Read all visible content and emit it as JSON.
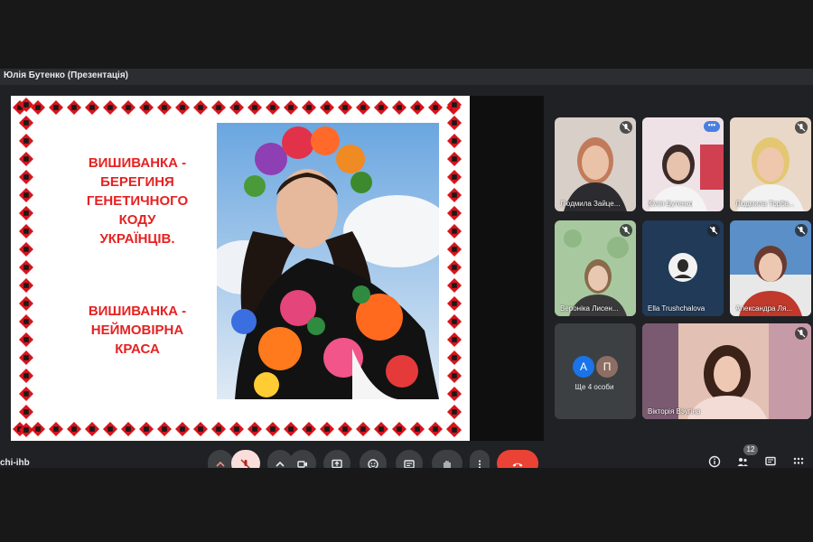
{
  "presenter": {
    "label": "Юлія Бутенко (Презентація)"
  },
  "slide": {
    "line1": [
      "ВИШИВАНКА  -",
      "БЕРЕГИНЯ",
      "ГЕНЕТИЧНОГО",
      "КОДУ",
      "УКРАЇНЦІВ."
    ],
    "line2": [
      "ВИШИВАНКА -",
      "НЕЙМОВІРНА",
      "КРАСА"
    ]
  },
  "participants": [
    {
      "name": "Людмила Зайце...",
      "muted": true
    },
    {
      "name": "Юлія Бутенко",
      "speaking": true,
      "menu": "•••"
    },
    {
      "name": "Людмила Торба...",
      "muted": true
    },
    {
      "name": "Вероніка Лисен...",
      "muted": true
    },
    {
      "name": "Ella Trushchalova",
      "muted": true
    },
    {
      "name": "Александра Ля...",
      "muted": true
    },
    {
      "name": "Вікторія Вэугіна",
      "muted": true
    }
  ],
  "others": {
    "initials": [
      "А",
      "П"
    ],
    "label": "Ще 4 особи",
    "colors": [
      "#1a73e8",
      "#8d6e63"
    ]
  },
  "toolbar": {
    "meeting_code": "chi-ihb",
    "people_count": "12"
  },
  "colors": {
    "ornament": "#d8141c",
    "slide_text": "#e52222",
    "end_call": "#ea4335",
    "mic_off": "#f28b82"
  }
}
